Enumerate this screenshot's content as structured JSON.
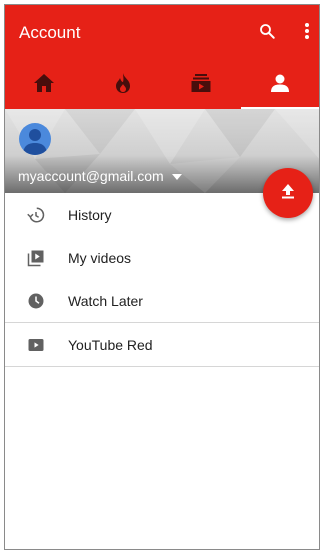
{
  "appbar": {
    "title": "Account",
    "icons": {
      "search": "search-icon",
      "more": "more-vert-icon"
    }
  },
  "tabs": [
    {
      "name": "home",
      "icon": "home-icon",
      "active": false
    },
    {
      "name": "trending",
      "icon": "trending-fire-icon",
      "active": false
    },
    {
      "name": "subscriptions",
      "icon": "subscriptions-icon",
      "active": false
    },
    {
      "name": "account",
      "icon": "account-icon",
      "active": true
    }
  ],
  "account": {
    "email": "myaccount@gmail.com"
  },
  "fab": {
    "icon": "upload-icon"
  },
  "menu": {
    "items": [
      {
        "label": "History",
        "icon": "history-icon"
      },
      {
        "label": "My videos",
        "icon": "my-videos-icon"
      },
      {
        "label": "Watch Later",
        "icon": "watch-later-icon"
      }
    ],
    "secondary": [
      {
        "label": "YouTube Red",
        "icon": "youtube-red-icon"
      }
    ]
  },
  "colors": {
    "brand": "#e62117",
    "text": "#212121",
    "icon": "#616161"
  }
}
